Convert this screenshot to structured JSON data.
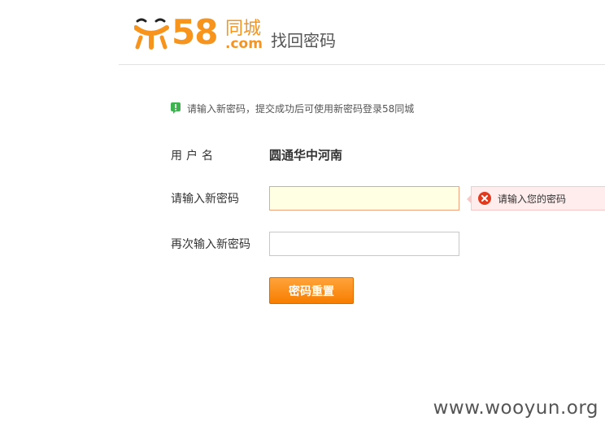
{
  "header": {
    "logo": {
      "number": "58",
      "city": "同城",
      "domain": ".com"
    },
    "title": "找回密码"
  },
  "notice": {
    "text": "请输入新密码，提交成功后可使用新密码登录58同城"
  },
  "form": {
    "username_label": "用户名",
    "username_value": "圆通华中河南",
    "new_password_label": "请输入新密码",
    "new_password_value": "",
    "confirm_password_label": "再次输入新密码",
    "confirm_password_value": "",
    "error_message": "请输入您的密码",
    "submit_label": "密码重置"
  },
  "watermark": "www.wooyun.org",
  "colors": {
    "brand_orange": "#f7941d",
    "notice_green": "#3fb34f",
    "error_red": "#e23a1d"
  }
}
